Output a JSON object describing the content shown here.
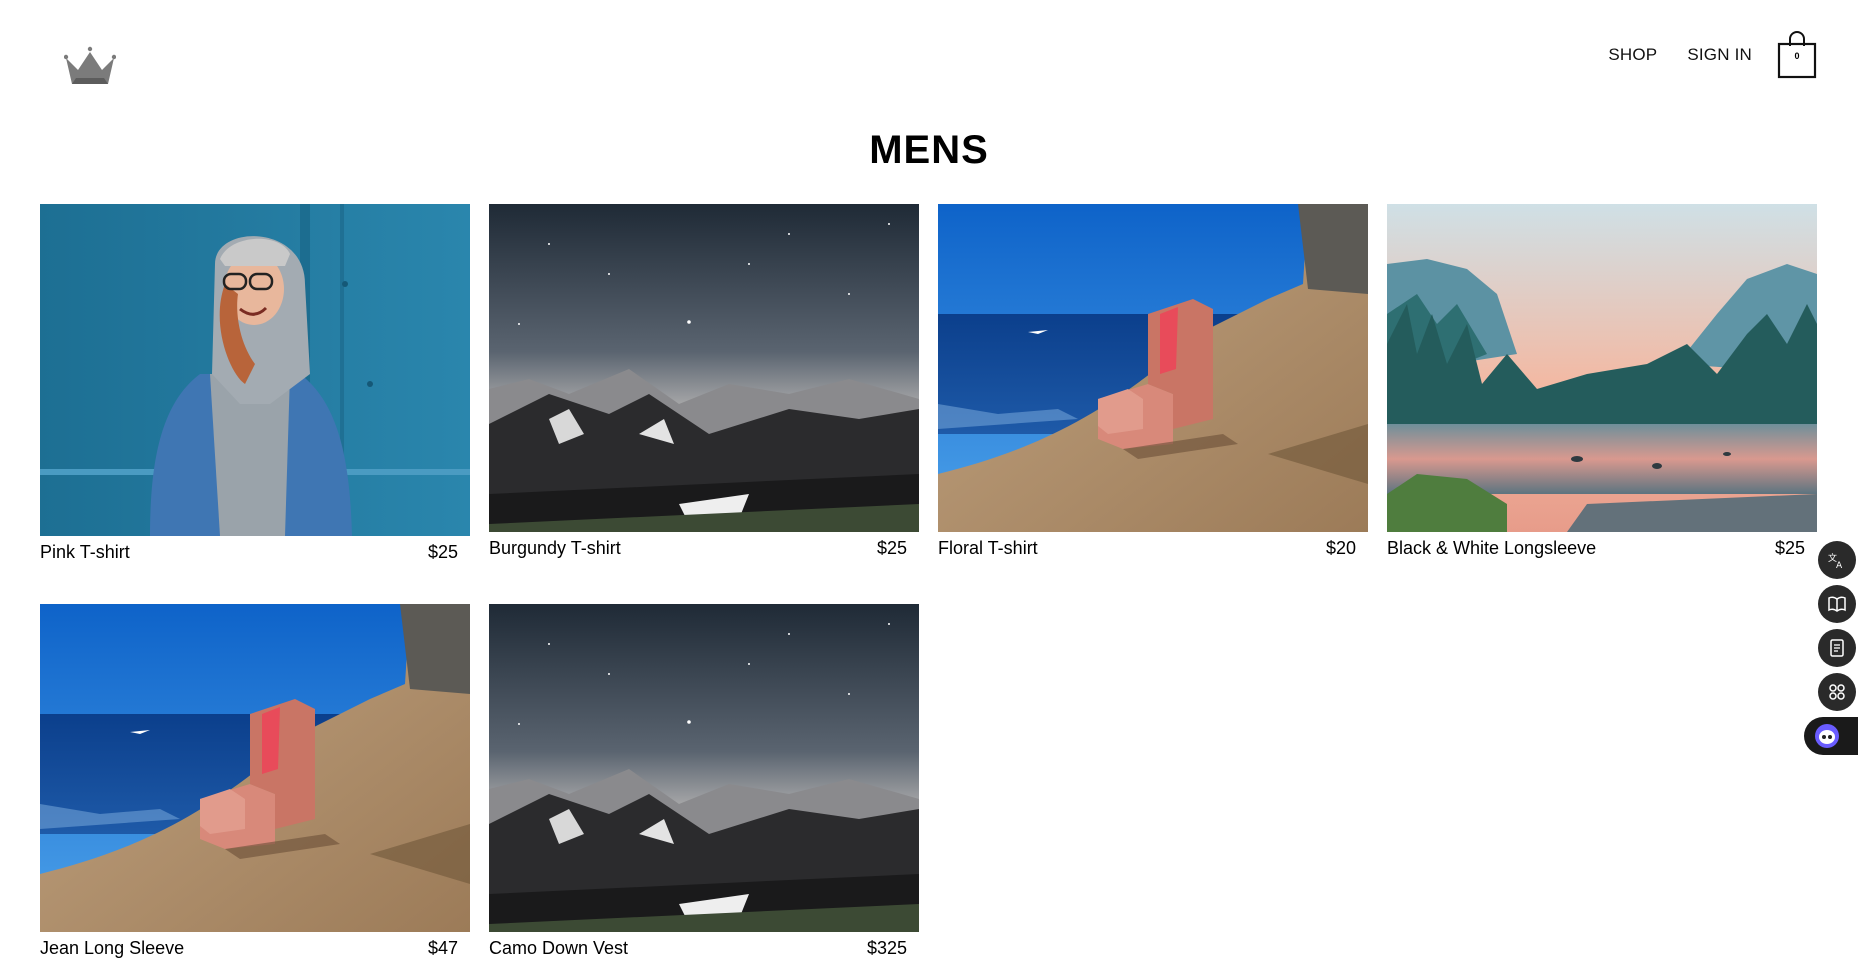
{
  "header": {
    "logo_icon": "crown-icon",
    "nav": [
      {
        "label": "SHOP"
      },
      {
        "label": "SIGN IN"
      }
    ],
    "cart": {
      "icon": "shopping-bag-icon",
      "count": "0"
    }
  },
  "page": {
    "title": "MENS"
  },
  "products": [
    {
      "name": "Pink T-shirt",
      "price": "$25",
      "image": "woman-in-denim-jacket-photo"
    },
    {
      "name": "Burgundy T-shirt",
      "price": "$25",
      "image": "starry-mountains-photo"
    },
    {
      "name": "Floral T-shirt",
      "price": "$20",
      "image": "pink-armchair-on-cliff-photo"
    },
    {
      "name": "Black & White Longsleeve",
      "price": "$25",
      "image": "valley-river-forest-photo"
    },
    {
      "name": "Jean Long Sleeve",
      "price": "$47",
      "image": "pink-armchair-on-cliff-photo"
    },
    {
      "name": "Camo Down Vest",
      "price": "$325",
      "image": "starry-mountains-photo"
    }
  ],
  "side_tools": [
    {
      "icon": "translate-icon"
    },
    {
      "icon": "book-icon"
    },
    {
      "icon": "notes-icon"
    },
    {
      "icon": "apps-icon"
    },
    {
      "icon": "assistant-bot-icon"
    }
  ]
}
